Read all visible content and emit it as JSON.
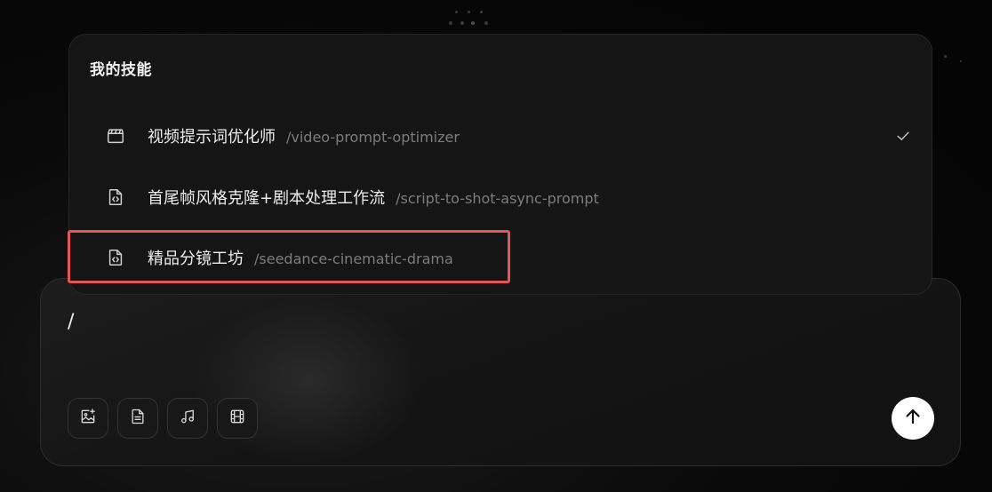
{
  "skills_panel": {
    "title": "我的技能",
    "items": [
      {
        "name": "视频提示词优化师",
        "command": "/video-prompt-optimizer",
        "icon": "clapperboard-icon",
        "selected": true
      },
      {
        "name": "首尾帧风格克隆+剧本处理工作流",
        "command": "/script-to-shot-async-prompt",
        "icon": "code-file-icon",
        "selected": false
      },
      {
        "name": "精品分镜工坊",
        "command": "/seedance-cinematic-drama",
        "icon": "code-file-icon",
        "selected": false,
        "highlighted": true
      }
    ]
  },
  "composer": {
    "input_value": "/",
    "tools": [
      "image-add-icon",
      "document-icon",
      "music-note-icon",
      "film-icon"
    ],
    "send_icon": "arrow-up-icon"
  },
  "colors": {
    "background": "#050505",
    "panel": "#151515",
    "highlight": "#e45555",
    "send_button": "#ffffff"
  }
}
